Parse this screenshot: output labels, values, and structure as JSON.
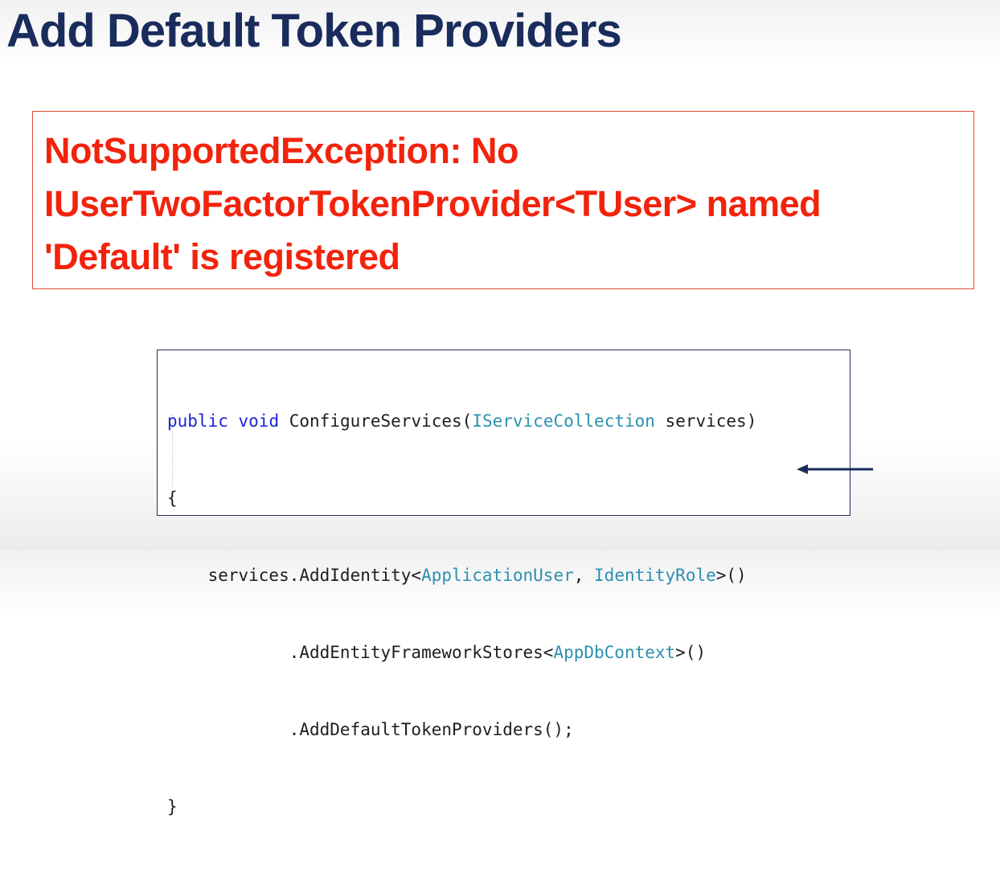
{
  "title": "Add Default Token Providers",
  "error": {
    "lines": [
      "NotSupportedException: No",
      "IUserTwoFactorTokenProvider<TUser> named",
      "'Default' is registered"
    ]
  },
  "code": {
    "line1": {
      "kw_public": "public",
      "kw_void": "void",
      "method": "ConfigureServices(",
      "type": "IServiceCollection",
      "rest": " services)"
    },
    "line2": "{",
    "line3": {
      "prefix": "    services.AddIdentity<",
      "type1": "ApplicationUser",
      "sep": ", ",
      "type2": "IdentityRole",
      "suffix": ">()"
    },
    "line4": {
      "prefix": "            .AddEntityFrameworkStores<",
      "type": "AppDbContext",
      "suffix": ">()"
    },
    "line5": "            .AddDefaultTokenProviders();",
    "line6": "}"
  },
  "colors": {
    "title": "#1a2c5c",
    "error_text": "#f2230c",
    "error_border": "#e24a33",
    "code_keyword": "#1a24d8",
    "code_type": "#2b91af",
    "code_border": "#1f2f5c",
    "arrow": "#1a2c5c"
  },
  "icons": {
    "arrow": "left-arrow-icon"
  }
}
